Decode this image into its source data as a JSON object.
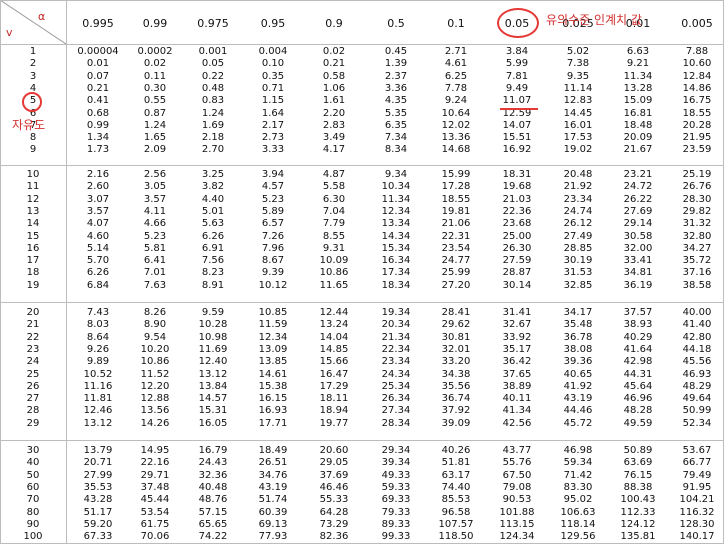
{
  "header": {
    "alpha_symbol": "α",
    "df_symbol": "v",
    "alphas": [
      "0.995",
      "0.99",
      "0.975",
      "0.95",
      "0.9",
      "0.5",
      "0.1",
      "0.05",
      "0.025",
      "0.01",
      "0.005"
    ]
  },
  "annotations": {
    "critical_value_label": "유의수준 인계치 값",
    "df_label": "자유도",
    "highlight_color": "#e53935"
  },
  "table": {
    "groups": [
      [
        {
          "df": "1",
          "v": [
            "0.00004",
            "0.0002",
            "0.001",
            "0.004",
            "0.02",
            "0.45",
            "2.71",
            "3.84",
            "5.02",
            "6.63",
            "7.88"
          ]
        },
        {
          "df": "2",
          "v": [
            "0.01",
            "0.02",
            "0.05",
            "0.10",
            "0.21",
            "1.39",
            "4.61",
            "5.99",
            "7.38",
            "9.21",
            "10.60"
          ]
        },
        {
          "df": "3",
          "v": [
            "0.07",
            "0.11",
            "0.22",
            "0.35",
            "0.58",
            "2.37",
            "6.25",
            "7.81",
            "9.35",
            "11.34",
            "12.84"
          ]
        },
        {
          "df": "4",
          "v": [
            "0.21",
            "0.30",
            "0.48",
            "0.71",
            "1.06",
            "3.36",
            "7.78",
            "9.49",
            "11.14",
            "13.28",
            "14.86"
          ]
        },
        {
          "df": "5",
          "v": [
            "0.41",
            "0.55",
            "0.83",
            "1.15",
            "1.61",
            "4.35",
            "9.24",
            "11.07",
            "12.83",
            "15.09",
            "16.75"
          ]
        },
        {
          "df": "6",
          "v": [
            "0.68",
            "0.87",
            "1.24",
            "1.64",
            "2.20",
            "5.35",
            "10.64",
            "12.59",
            "14.45",
            "16.81",
            "18.55"
          ]
        },
        {
          "df": "7",
          "v": [
            "0.99",
            "1.24",
            "1.69",
            "2.17",
            "2.83",
            "6.35",
            "12.02",
            "14.07",
            "16.01",
            "18.48",
            "20.28"
          ]
        },
        {
          "df": "8",
          "v": [
            "1.34",
            "1.65",
            "2.18",
            "2.73",
            "3.49",
            "7.34",
            "13.36",
            "15.51",
            "17.53",
            "20.09",
            "21.95"
          ]
        },
        {
          "df": "9",
          "v": [
            "1.73",
            "2.09",
            "2.70",
            "3.33",
            "4.17",
            "8.34",
            "14.68",
            "16.92",
            "19.02",
            "21.67",
            "23.59"
          ]
        }
      ],
      [
        {
          "df": "10",
          "v": [
            "2.16",
            "2.56",
            "3.25",
            "3.94",
            "4.87",
            "9.34",
            "15.99",
            "18.31",
            "20.48",
            "23.21",
            "25.19"
          ]
        },
        {
          "df": "11",
          "v": [
            "2.60",
            "3.05",
            "3.82",
            "4.57",
            "5.58",
            "10.34",
            "17.28",
            "19.68",
            "21.92",
            "24.72",
            "26.76"
          ]
        },
        {
          "df": "12",
          "v": [
            "3.07",
            "3.57",
            "4.40",
            "5.23",
            "6.30",
            "11.34",
            "18.55",
            "21.03",
            "23.34",
            "26.22",
            "28.30"
          ]
        },
        {
          "df": "13",
          "v": [
            "3.57",
            "4.11",
            "5.01",
            "5.89",
            "7.04",
            "12.34",
            "19.81",
            "22.36",
            "24.74",
            "27.69",
            "29.82"
          ]
        },
        {
          "df": "14",
          "v": [
            "4.07",
            "4.66",
            "5.63",
            "6.57",
            "7.79",
            "13.34",
            "21.06",
            "23.68",
            "26.12",
            "29.14",
            "31.32"
          ]
        },
        {
          "df": "15",
          "v": [
            "4.60",
            "5.23",
            "6.26",
            "7.26",
            "8.55",
            "14.34",
            "22.31",
            "25.00",
            "27.49",
            "30.58",
            "32.80"
          ]
        },
        {
          "df": "16",
          "v": [
            "5.14",
            "5.81",
            "6.91",
            "7.96",
            "9.31",
            "15.34",
            "23.54",
            "26.30",
            "28.85",
            "32.00",
            "34.27"
          ]
        },
        {
          "df": "17",
          "v": [
            "5.70",
            "6.41",
            "7.56",
            "8.67",
            "10.09",
            "16.34",
            "24.77",
            "27.59",
            "30.19",
            "33.41",
            "35.72"
          ]
        },
        {
          "df": "18",
          "v": [
            "6.26",
            "7.01",
            "8.23",
            "9.39",
            "10.86",
            "17.34",
            "25.99",
            "28.87",
            "31.53",
            "34.81",
            "37.16"
          ]
        },
        {
          "df": "19",
          "v": [
            "6.84",
            "7.63",
            "8.91",
            "10.12",
            "11.65",
            "18.34",
            "27.20",
            "30.14",
            "32.85",
            "36.19",
            "38.58"
          ]
        }
      ],
      [
        {
          "df": "20",
          "v": [
            "7.43",
            "8.26",
            "9.59",
            "10.85",
            "12.44",
            "19.34",
            "28.41",
            "31.41",
            "34.17",
            "37.57",
            "40.00"
          ]
        },
        {
          "df": "21",
          "v": [
            "8.03",
            "8.90",
            "10.28",
            "11.59",
            "13.24",
            "20.34",
            "29.62",
            "32.67",
            "35.48",
            "38.93",
            "41.40"
          ]
        },
        {
          "df": "22",
          "v": [
            "8.64",
            "9.54",
            "10.98",
            "12.34",
            "14.04",
            "21.34",
            "30.81",
            "33.92",
            "36.78",
            "40.29",
            "42.80"
          ]
        },
        {
          "df": "23",
          "v": [
            "9.26",
            "10.20",
            "11.69",
            "13.09",
            "14.85",
            "22.34",
            "32.01",
            "35.17",
            "38.08",
            "41.64",
            "44.18"
          ]
        },
        {
          "df": "24",
          "v": [
            "9.89",
            "10.86",
            "12.40",
            "13.85",
            "15.66",
            "23.34",
            "33.20",
            "36.42",
            "39.36",
            "42.98",
            "45.56"
          ]
        },
        {
          "df": "25",
          "v": [
            "10.52",
            "11.52",
            "13.12",
            "14.61",
            "16.47",
            "24.34",
            "34.38",
            "37.65",
            "40.65",
            "44.31",
            "46.93"
          ]
        },
        {
          "df": "26",
          "v": [
            "11.16",
            "12.20",
            "13.84",
            "15.38",
            "17.29",
            "25.34",
            "35.56",
            "38.89",
            "41.92",
            "45.64",
            "48.29"
          ]
        },
        {
          "df": "27",
          "v": [
            "11.81",
            "12.88",
            "14.57",
            "16.15",
            "18.11",
            "26.34",
            "36.74",
            "40.11",
            "43.19",
            "46.96",
            "49.64"
          ]
        },
        {
          "df": "28",
          "v": [
            "12.46",
            "13.56",
            "15.31",
            "16.93",
            "18.94",
            "27.34",
            "37.92",
            "41.34",
            "44.46",
            "48.28",
            "50.99"
          ]
        },
        {
          "df": "29",
          "v": [
            "13.12",
            "14.26",
            "16.05",
            "17.71",
            "19.77",
            "28.34",
            "39.09",
            "42.56",
            "45.72",
            "49.59",
            "52.34"
          ]
        }
      ],
      [
        {
          "df": "30",
          "v": [
            "13.79",
            "14.95",
            "16.79",
            "18.49",
            "20.60",
            "29.34",
            "40.26",
            "43.77",
            "46.98",
            "50.89",
            "53.67"
          ]
        },
        {
          "df": "40",
          "v": [
            "20.71",
            "22.16",
            "24.43",
            "26.51",
            "29.05",
            "39.34",
            "51.81",
            "55.76",
            "59.34",
            "63.69",
            "66.77"
          ]
        },
        {
          "df": "50",
          "v": [
            "27.99",
            "29.71",
            "32.36",
            "34.76",
            "37.69",
            "49.33",
            "63.17",
            "67.50",
            "71.42",
            "76.15",
            "79.49"
          ]
        },
        {
          "df": "60",
          "v": [
            "35.53",
            "37.48",
            "40.48",
            "43.19",
            "46.46",
            "59.33",
            "74.40",
            "79.08",
            "83.30",
            "88.38",
            "91.95"
          ]
        },
        {
          "df": "70",
          "v": [
            "43.28",
            "45.44",
            "48.76",
            "51.74",
            "55.33",
            "69.33",
            "85.53",
            "90.53",
            "95.02",
            "100.43",
            "104.21"
          ]
        },
        {
          "df": "80",
          "v": [
            "51.17",
            "53.54",
            "57.15",
            "60.39",
            "64.28",
            "79.33",
            "96.58",
            "101.88",
            "106.63",
            "112.33",
            "116.32"
          ]
        },
        {
          "df": "90",
          "v": [
            "59.20",
            "61.75",
            "65.65",
            "69.13",
            "73.29",
            "89.33",
            "107.57",
            "113.15",
            "118.14",
            "124.12",
            "128.30"
          ]
        },
        {
          "df": "100",
          "v": [
            "67.33",
            "70.06",
            "74.22",
            "77.93",
            "82.36",
            "99.33",
            "118.50",
            "124.34",
            "129.56",
            "135.81",
            "140.17"
          ]
        }
      ]
    ]
  }
}
